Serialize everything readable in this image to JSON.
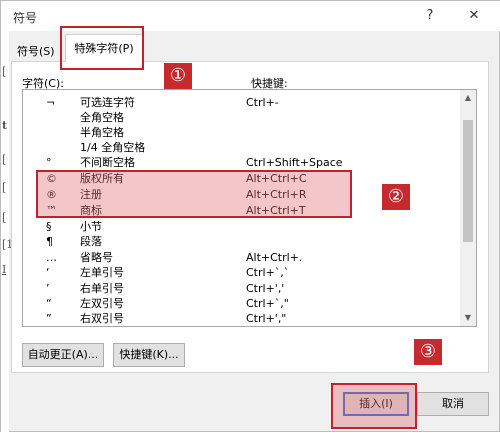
{
  "dialog": {
    "title": "符号",
    "help_glyph": "?",
    "close_glyph": "✕"
  },
  "background_fragments": [
    "[",
    "t",
    "[",
    "[",
    "[",
    "[1",
    "I"
  ],
  "tabs": [
    {
      "label": "符号(S)"
    },
    {
      "label": "特殊字符(P)"
    }
  ],
  "list_header": {
    "char_label": "字符(C):",
    "shortcut_label": "快捷键:"
  },
  "special_chars": [
    {
      "symbol": "¬",
      "name": "可选连字符",
      "shortcut": "Ctrl+-"
    },
    {
      "symbol": "",
      "name": "全角空格",
      "shortcut": ""
    },
    {
      "symbol": "",
      "name": "半角空格",
      "shortcut": ""
    },
    {
      "symbol": "",
      "name": "1/4 全角空格",
      "shortcut": ""
    },
    {
      "symbol": "°",
      "name": "不间断空格",
      "shortcut": "Ctrl+Shift+Space"
    },
    {
      "symbol": "©",
      "name": "版权所有",
      "shortcut": "Alt+Ctrl+C"
    },
    {
      "symbol": "®",
      "name": "注册",
      "shortcut": "Alt+Ctrl+R"
    },
    {
      "symbol": "™",
      "name": "商标",
      "shortcut": "Alt+Ctrl+T"
    },
    {
      "symbol": "§",
      "name": "小节",
      "shortcut": ""
    },
    {
      "symbol": "¶",
      "name": "段落",
      "shortcut": ""
    },
    {
      "symbol": "…",
      "name": "省略号",
      "shortcut": "Alt+Ctrl+."
    },
    {
      "symbol": "‘",
      "name": "左单引号",
      "shortcut": "Ctrl+`,`"
    },
    {
      "symbol": "’",
      "name": "右单引号",
      "shortcut": "Ctrl+','"
    },
    {
      "symbol": "“",
      "name": "左双引号",
      "shortcut": "Ctrl+`,\""
    },
    {
      "symbol": "”",
      "name": "右双引号",
      "shortcut": "Ctrl+',\""
    }
  ],
  "buttons": {
    "autocorrect": "自动更正(A)...",
    "shortcut_key": "快捷键(K)...",
    "insert": "插入(I)",
    "cancel": "取消"
  },
  "annotations": {
    "marker_1": "①",
    "marker_2": "②",
    "marker_3": "③",
    "highlight_color": "#c0232c"
  },
  "colors": {
    "dialog_bg": "#f0f0f0",
    "button_bg": "#e1e1e1",
    "focus_border": "#2b6fd0",
    "marker_bg": "#c52a2f"
  }
}
